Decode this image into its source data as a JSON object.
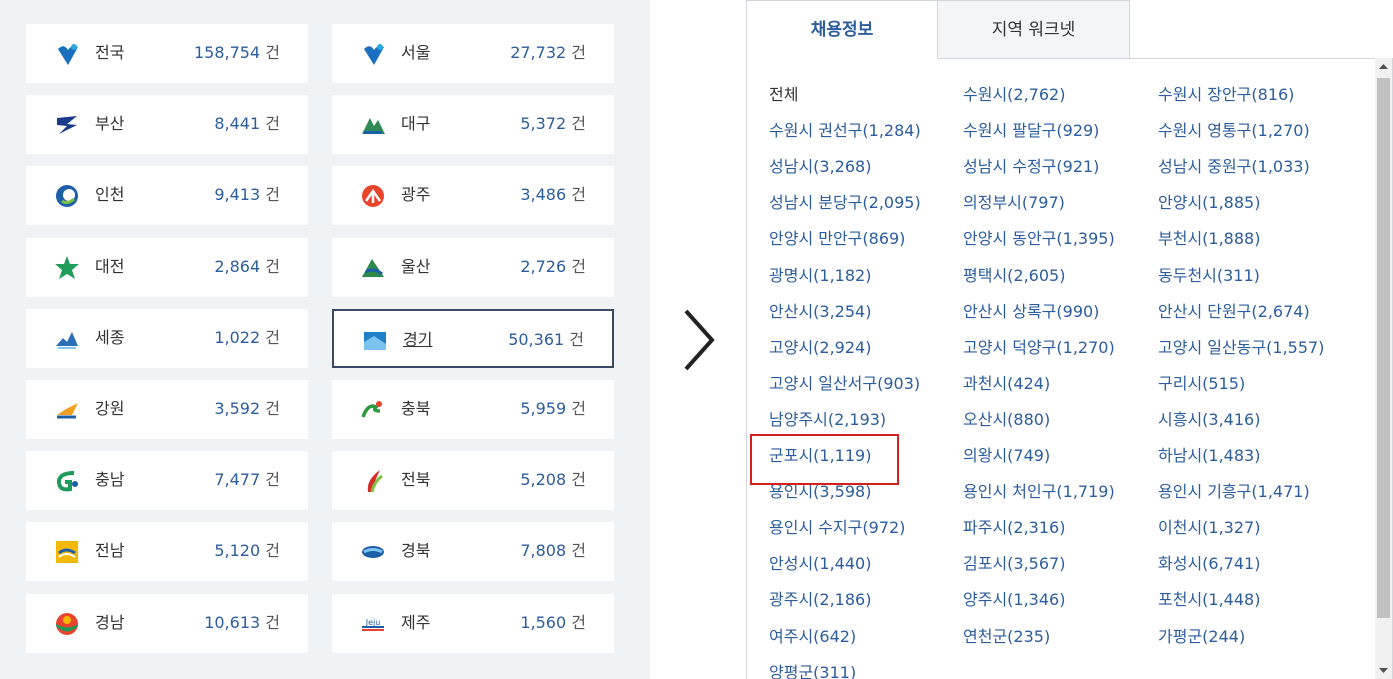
{
  "regions": [
    {
      "name": "전국",
      "count": "158,754",
      "unit": "건",
      "icon": "nation-logo-icon",
      "color": "#1b6fc0"
    },
    {
      "name": "서울",
      "count": "27,732",
      "unit": "건",
      "icon": "seoul-logo-icon",
      "color": "#1b6fc0"
    },
    {
      "name": "부산",
      "count": "8,441",
      "unit": "건",
      "icon": "busan-logo-icon",
      "color": "#1a3a8c"
    },
    {
      "name": "대구",
      "count": "5,372",
      "unit": "건",
      "icon": "daegu-logo-icon",
      "color": "#2e8b57"
    },
    {
      "name": "인천",
      "count": "9,413",
      "unit": "건",
      "icon": "incheon-logo-icon",
      "color": "#1d5ea8"
    },
    {
      "name": "광주",
      "count": "3,486",
      "unit": "건",
      "icon": "gwangju-logo-icon",
      "color": "#e8442d"
    },
    {
      "name": "대전",
      "count": "2,864",
      "unit": "건",
      "icon": "daejeon-logo-icon",
      "color": "#1e9e5a"
    },
    {
      "name": "울산",
      "count": "2,726",
      "unit": "건",
      "icon": "ulsan-logo-icon",
      "color": "#2a8a4a"
    },
    {
      "name": "세종",
      "count": "1,022",
      "unit": "건",
      "icon": "sejong-logo-icon",
      "color": "#2c6fb8"
    },
    {
      "name": "경기",
      "count": "50,361",
      "unit": "건",
      "icon": "gyeonggi-logo-icon",
      "color": "#1f7fc9"
    },
    {
      "name": "강원",
      "count": "3,592",
      "unit": "건",
      "icon": "gangwon-logo-icon",
      "color": "#f0a020"
    },
    {
      "name": "충북",
      "count": "5,959",
      "unit": "건",
      "icon": "chungbuk-logo-icon",
      "color": "#2a9a3a"
    },
    {
      "name": "충남",
      "count": "7,477",
      "unit": "건",
      "icon": "chungnam-logo-icon",
      "color": "#1e9a5a"
    },
    {
      "name": "전북",
      "count": "5,208",
      "unit": "건",
      "icon": "jeonbuk-logo-icon",
      "color": "#d92a2a"
    },
    {
      "name": "전남",
      "count": "5,120",
      "unit": "건",
      "icon": "jeonnam-logo-icon",
      "color": "#f5b800"
    },
    {
      "name": "경북",
      "count": "7,808",
      "unit": "건",
      "icon": "gyeongbuk-logo-icon",
      "color": "#1d5ea8"
    },
    {
      "name": "경남",
      "count": "10,613",
      "unit": "건",
      "icon": "gyeongnam-logo-icon",
      "color": "#e8442d"
    },
    {
      "name": "제주",
      "count": "1,560",
      "unit": "건",
      "icon": "jeju-logo-icon",
      "color": "#1d5ea8"
    }
  ],
  "selected_region": "경기",
  "tabs": [
    {
      "label": "채용정보",
      "active": true
    },
    {
      "label": "지역 워크넷",
      "active": false
    }
  ],
  "city_list": [
    "전체",
    "수원시(2,762)",
    "수원시 장안구(816)",
    "수원시 권선구(1,284)",
    "수원시 팔달구(929)",
    "수원시 영통구(1,270)",
    "성남시(3,268)",
    "성남시 수정구(921)",
    "성남시 중원구(1,033)",
    "성남시 분당구(2,095)",
    "의정부시(797)",
    "안양시(1,885)",
    "안양시 만안구(869)",
    "안양시 동안구(1,395)",
    "부천시(1,888)",
    "광명시(1,182)",
    "평택시(2,605)",
    "동두천시(311)",
    "안산시(3,254)",
    "안산시 상록구(990)",
    "안산시 단원구(2,674)",
    "고양시(2,924)",
    "고양시 덕양구(1,270)",
    "고양시 일산동구(1,557)",
    "고양시 일산서구(903)",
    "과천시(424)",
    "구리시(515)",
    "남양주시(2,193)",
    "오산시(880)",
    "시흥시(3,416)",
    "군포시(1,119)",
    "의왕시(749)",
    "하남시(1,483)",
    "용인시(3,598)",
    "용인시 처인구(1,719)",
    "용인시 기흥구(1,471)",
    "용인시 수지구(972)",
    "파주시(2,316)",
    "이천시(1,327)",
    "안성시(1,440)",
    "김포시(3,567)",
    "화성시(6,741)",
    "광주시(2,186)",
    "양주시(1,346)",
    "포천시(1,448)",
    "여주시(642)",
    "연천군(235)",
    "가평군(244)",
    "양평군(311)"
  ],
  "highlighted_city": "군포시(1,119)",
  "colors": {
    "accent": "#2c5d9e",
    "highlight": "#d41f1f",
    "panel_bg": "#f0f3f6"
  }
}
